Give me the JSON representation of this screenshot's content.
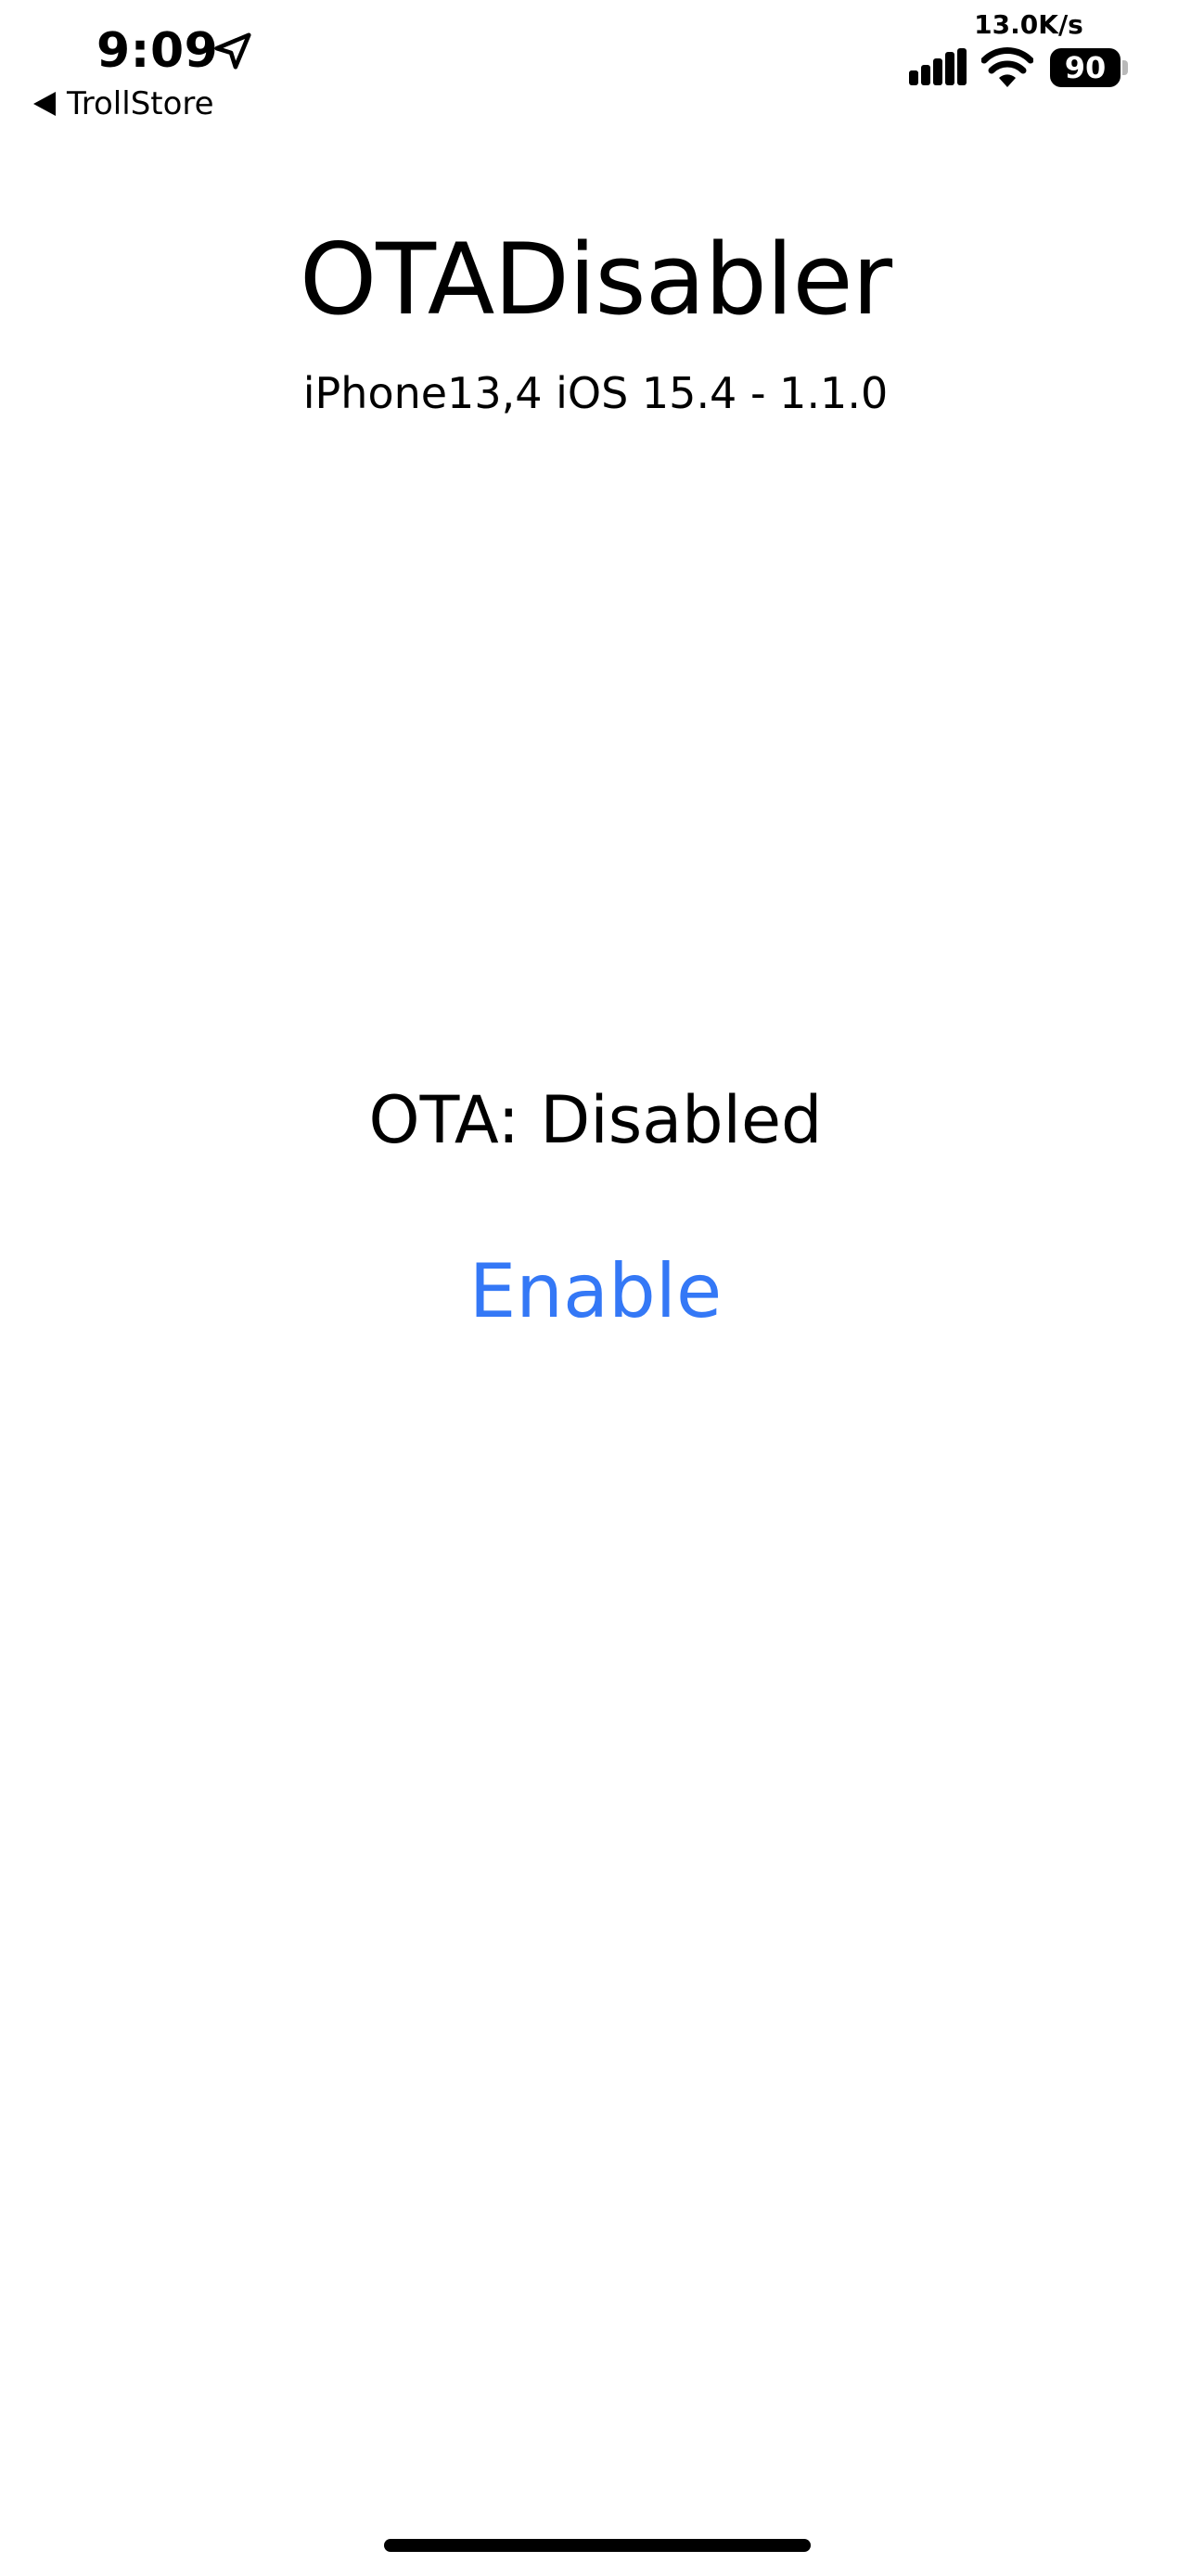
{
  "status_bar": {
    "time": "9:09",
    "back_app_label": "TrollStore",
    "network_speed": "13.0K/s",
    "battery_level": "90",
    "icons": {
      "location": "location-arrow-icon",
      "back": "back-triangle-icon",
      "signal": "cellular-signal-icon",
      "wifi": "wifi-icon",
      "battery": "battery-icon"
    }
  },
  "app": {
    "title": "OTADisabler",
    "device_info": "iPhone13,4 iOS 15.4 - 1.1.0",
    "ota_status": "OTA: Disabled",
    "enable_label": "Enable"
  },
  "colors": {
    "accent": "#3478f6",
    "text": "#000000",
    "background": "#ffffff"
  }
}
